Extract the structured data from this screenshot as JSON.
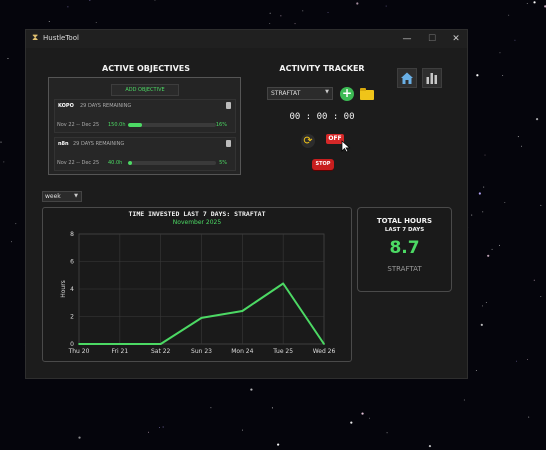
{
  "window": {
    "title": "HustleTool",
    "icon": "hourglass-icon"
  },
  "objectives": {
    "heading": "ACTIVE OBJECTIVES",
    "add_label": "ADD OBJECTIVE",
    "items": [
      {
        "name": "KOPO",
        "remaining": "29 DAYS REMAINING",
        "dates": "Nov 22 -- Dec 25",
        "hours": "150.0h",
        "progress": 0.16,
        "percent": "16%"
      },
      {
        "name": "n8n",
        "remaining": "29 DAYS REMAINING",
        "dates": "Nov 22 -- Dec 25",
        "hours": "40.0h",
        "progress": 0.05,
        "percent": "5%"
      }
    ]
  },
  "tracker": {
    "heading": "ACTIVITY TRACKER",
    "activity": "STRAFTAT",
    "timer": "00 : 00 : 00",
    "toggle_label": "OFF",
    "stop_label": "STOP"
  },
  "period": {
    "selected": "week"
  },
  "chart": {
    "title": "TIME INVESTED LAST 7 DAYS: STRAFTAT",
    "subtitle": "November 2025"
  },
  "totals": {
    "title": "TOTAL HOURS",
    "subtitle": "LAST 7 DAYS",
    "value": "8.7",
    "activity": "STRAFTAT"
  },
  "colors": {
    "accent": "#4cd964",
    "danger": "#d62828",
    "folder": "#f0c419",
    "home": "#6ab0e6"
  },
  "chart_data": {
    "type": "line",
    "categories": [
      "Thu 20",
      "Fri 21",
      "Sat 22",
      "Sun 23",
      "Mon 24",
      "Tue 25",
      "Wed 26"
    ],
    "values": [
      0,
      0,
      0,
      1.9,
      2.4,
      4.4,
      0
    ],
    "ylabel": "Hours",
    "ylim": [
      0,
      8
    ],
    "yticks": [
      0,
      2,
      4,
      6,
      8
    ],
    "grid": true,
    "series_color": "#4cd964"
  }
}
